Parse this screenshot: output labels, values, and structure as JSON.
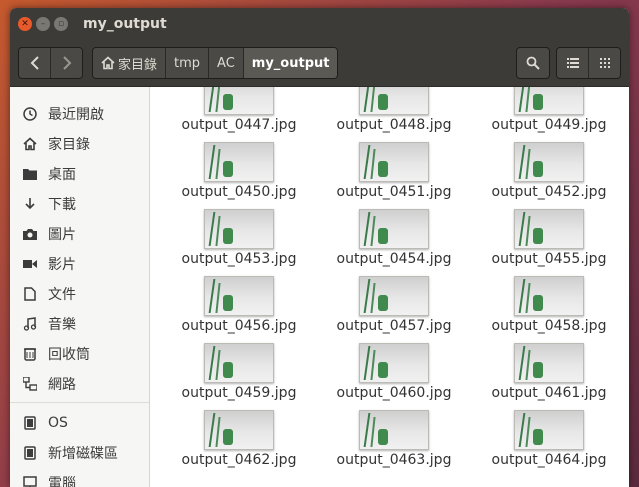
{
  "window": {
    "title": "my_output"
  },
  "pathbar": {
    "crumbs": [
      {
        "label": "家目錄",
        "home": true
      },
      {
        "label": "tmp"
      },
      {
        "label": "AC"
      },
      {
        "label": "my_output",
        "active": true
      }
    ]
  },
  "sidebar": {
    "items": [
      {
        "label": "最近開啟",
        "icon": "clock-icon"
      },
      {
        "label": "家目錄",
        "icon": "home-icon"
      },
      {
        "label": "桌面",
        "icon": "folder-icon"
      },
      {
        "label": "下載",
        "icon": "download-icon"
      },
      {
        "label": "圖片",
        "icon": "camera-icon"
      },
      {
        "label": "影片",
        "icon": "video-icon"
      },
      {
        "label": "文件",
        "icon": "document-icon"
      },
      {
        "label": "音樂",
        "icon": "music-icon"
      },
      {
        "label": "回收筒",
        "icon": "trash-icon"
      },
      {
        "label": "網路",
        "icon": "network-icon"
      },
      {
        "label": "OS",
        "icon": "drive-icon"
      },
      {
        "label": "新增磁碟區",
        "icon": "drive-icon"
      },
      {
        "label": "電腦",
        "icon": "computer-icon"
      }
    ]
  },
  "files": [
    "output_0447.jpg",
    "output_0448.jpg",
    "output_0449.jpg",
    "output_0450.jpg",
    "output_0451.jpg",
    "output_0452.jpg",
    "output_0453.jpg",
    "output_0454.jpg",
    "output_0455.jpg",
    "output_0456.jpg",
    "output_0457.jpg",
    "output_0458.jpg",
    "output_0459.jpg",
    "output_0460.jpg",
    "output_0461.jpg",
    "output_0462.jpg",
    "output_0463.jpg",
    "output_0464.jpg"
  ]
}
